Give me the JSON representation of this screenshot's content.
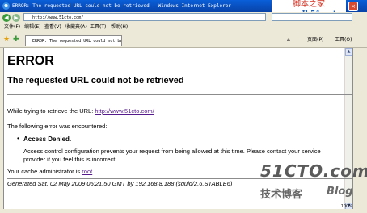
{
  "window": {
    "title": "ERROR: The requested URL could not be retrieved - Windows Internet Explorer"
  },
  "watermark_top": {
    "line1": "脚本之家",
    "line2": "www.Jb51.net"
  },
  "address": {
    "url": "http://www.51cto.com/"
  },
  "menu": {
    "items": [
      "文件(F)",
      "编辑(E)",
      "查看(V)",
      "收藏夹(A)",
      "工具(T)",
      "帮助(H)"
    ]
  },
  "tab": {
    "label": "ERROR: The requested URL could not be retrieved"
  },
  "tab_tools": {
    "page": "页面(P)",
    "tools": "工具(O)"
  },
  "page": {
    "heading": "ERROR",
    "subheading": "The requested URL could not be retrieved",
    "retrieve_prefix": "While trying to retrieve the URL: ",
    "retrieve_url": "http://www.51cto.com/",
    "error_intro": "The following error was encountered:",
    "error_title": "Access Denied.",
    "error_desc_1": "Access control configuration prevents your request from being allowed at this time. Please contact your service",
    "error_desc_2": "provider if you feel this is incorrect.",
    "admin_prefix": "Your cache administrator is ",
    "admin_link": "root",
    "admin_suffix": ".",
    "generated": "Generated Sat, 02 May 2009 05:21:50 GMT by 192.168.8.188 (squid/2.6.STABLE6)"
  },
  "watermark_bottom": {
    "line1": "51CTO.com",
    "line2": "技术博客",
    "line3": "Blog"
  },
  "status": {
    "zoom": "100%"
  }
}
